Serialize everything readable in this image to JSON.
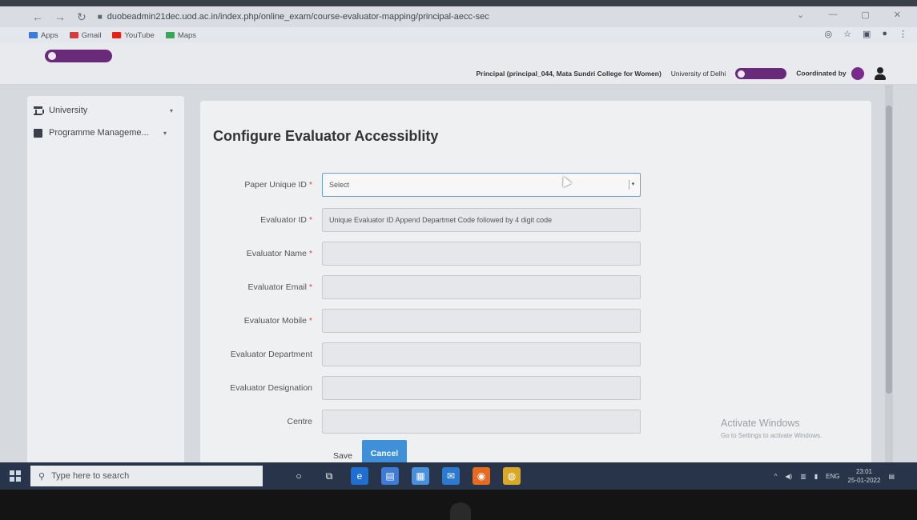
{
  "browser": {
    "url": "duobeadmin21dec.uod.ac.in/index.php/online_exam/course-evaluator-mapping/principal-aecc-sec",
    "bookmarks": [
      {
        "label": "Apps",
        "color": "#3b7bd9"
      },
      {
        "label": "Gmail",
        "color": "#d93b3b"
      },
      {
        "label": "YouTube",
        "color": "#e62117"
      },
      {
        "label": "Maps",
        "color": "#34a853"
      }
    ]
  },
  "header": {
    "user_info": "Principal (principal_044, Mata Sundri College for Women)",
    "university": "University of Delhi",
    "coordinated_by": "Coordinated by"
  },
  "sidebar": {
    "items": [
      {
        "label": "University"
      },
      {
        "label": "Programme Manageme..."
      }
    ]
  },
  "form": {
    "title": "Configure Evaluator Accessiblity",
    "fields": [
      {
        "label": "Paper Unique ID",
        "required": "*",
        "value": "Select"
      },
      {
        "label": "Evaluator ID",
        "required": "*",
        "value": "Unique Evaluator ID Append Departmet Code followed by 4 digit code"
      },
      {
        "label": "Evaluator Name",
        "required": "*",
        "value": ""
      },
      {
        "label": "Evaluator Email",
        "required": "*",
        "value": ""
      },
      {
        "label": "Evaluator Mobile",
        "required": "*",
        "value": ""
      },
      {
        "label": "Evaluator Department",
        "required": "",
        "value": ""
      },
      {
        "label": "Evaluator Designation",
        "required": "",
        "value": ""
      },
      {
        "label": "Centre",
        "required": "",
        "value": ""
      }
    ],
    "save_label": "Save",
    "cancel_label": "Cancel"
  },
  "watermark": {
    "line1": "Activate Windows",
    "line2": "Go to Settings to activate Windows."
  },
  "taskbar": {
    "search_placeholder": "Type here to search",
    "lang": "ENG",
    "time": "23:01",
    "date": "25-01-2022"
  }
}
